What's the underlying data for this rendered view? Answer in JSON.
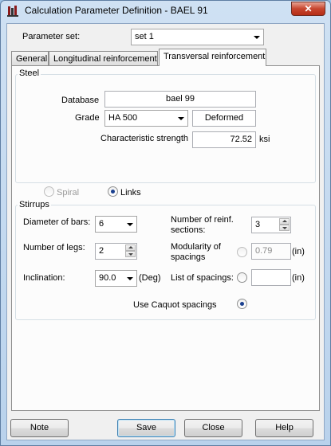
{
  "window": {
    "title": "Calculation Parameter Definition - BAEL 91",
    "close_glyph": "✕"
  },
  "parameter_set": {
    "label": "Parameter set:",
    "value": "set 1"
  },
  "tabs": [
    {
      "label": "General"
    },
    {
      "label": "Longitudinal reinforcement"
    },
    {
      "label": "Transversal reinforcement"
    }
  ],
  "steel": {
    "group_title": "Steel",
    "database_label": "Database",
    "database_value": "bael 99",
    "grade_label": "Grade",
    "grade_value": "HA 500",
    "type_value": "Deformed",
    "strength_label": "Characteristic strength",
    "strength_value": "72.52",
    "strength_unit": "ksi"
  },
  "type_options": {
    "spiral_label": "Spiral",
    "links_label": "Links",
    "selected": "Links"
  },
  "stirrups": {
    "group_title": "Stirrups",
    "diameter_label": "Diameter of bars:",
    "diameter_value": "6",
    "sections_label_1": "Number of reinf.",
    "sections_label_2": "sections:",
    "sections_value": "3",
    "legs_label": "Number of legs:",
    "legs_value": "2",
    "modularity_label_1": "Modularity of",
    "modularity_label_2": "spacings",
    "modularity_value": "0.79",
    "modularity_unit": "(in)",
    "inclination_label": "Inclination:",
    "inclination_value": "90.0",
    "inclination_unit": "(Deg)",
    "spacing_list_label": "List of spacings:",
    "spacing_list_value": "",
    "spacing_list_unit": "(in)",
    "caquot_label": "Use Caquot spacings"
  },
  "buttons": {
    "note": "Note",
    "save": "Save",
    "close": "Close",
    "help": "Help"
  }
}
